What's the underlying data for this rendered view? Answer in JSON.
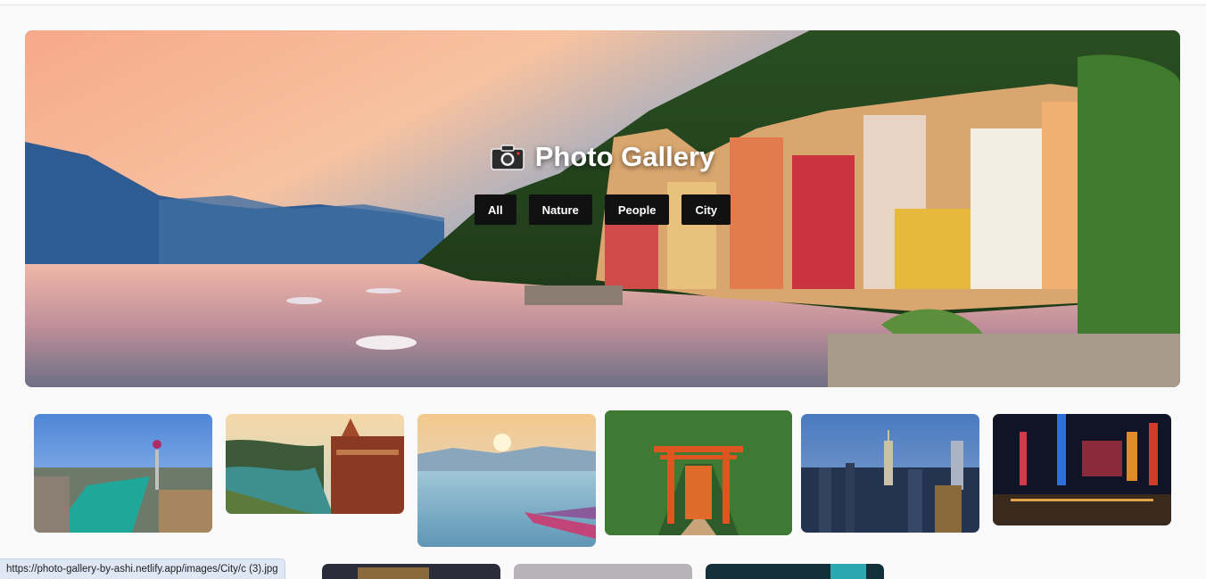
{
  "hero": {
    "title": "Photo Gallery",
    "camera_icon": "camera-icon"
  },
  "filters": [
    {
      "label": "All"
    },
    {
      "label": "Nature"
    },
    {
      "label": "People"
    },
    {
      "label": "City"
    }
  ],
  "gallery": {
    "row1": [
      {
        "subject": "coastal city with tower"
      },
      {
        "subject": "palace by river"
      },
      {
        "subject": "lake with boat at sunrise"
      },
      {
        "subject": "red torii gate in forest"
      },
      {
        "subject": "city skyline at dusk"
      },
      {
        "subject": "neon street at night"
      }
    ],
    "row2_partial": 3
  },
  "status": {
    "url": "https://photo-gallery-by-ashi.netlify.app/images/City/c (3).jpg"
  },
  "colors": {
    "button_bg": "#111111",
    "page_bg": "#f9f9f9"
  }
}
